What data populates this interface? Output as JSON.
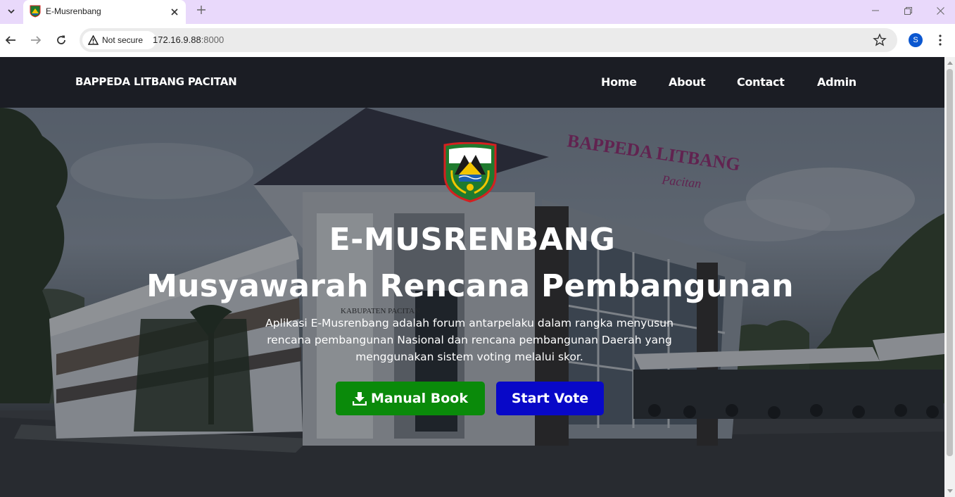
{
  "browser": {
    "tab_title": "E-Musrenbang",
    "security_label": "Not secure",
    "url_host": "172.16.9.88",
    "url_port": ":8000",
    "profile_initial": "S"
  },
  "site": {
    "brand": "BAPPEDA LITBANG PACITAN",
    "nav": [
      "Home",
      "About",
      "Contact",
      "Admin"
    ]
  },
  "hero": {
    "title_line1": "E-MUSRENBANG",
    "title_line2": "Musyawarah Rencana Pembangunan",
    "description": "Aplikasi E-Musrenbang adalah forum antarpelaku dalam rangka menyusun rencana pembangunan Nasional dan rencana pembangunan Daerah yang menggunakan sistem voting melalui skor.",
    "manual_button": "Manual Book",
    "vote_button": "Start Vote",
    "building_sign_line1": "BAPPEDA LITBANG",
    "building_sign_line2": "Pacitan",
    "building_plaque": "KABUPATEN PACITAN"
  },
  "colors": {
    "tabstrip": "#e9d9fb",
    "navbar": "#1b1d24",
    "manual_button": "#0a8a0a",
    "vote_button": "#0808c8"
  },
  "icons": [
    "tab-search-icon",
    "favicon-icon",
    "close-icon",
    "plus-icon",
    "minimize-icon",
    "restore-icon",
    "window-close-icon",
    "back-arrow-icon",
    "forward-arrow-icon",
    "reload-icon",
    "warning-icon",
    "star-icon",
    "more-vert-icon",
    "download-icon"
  ]
}
